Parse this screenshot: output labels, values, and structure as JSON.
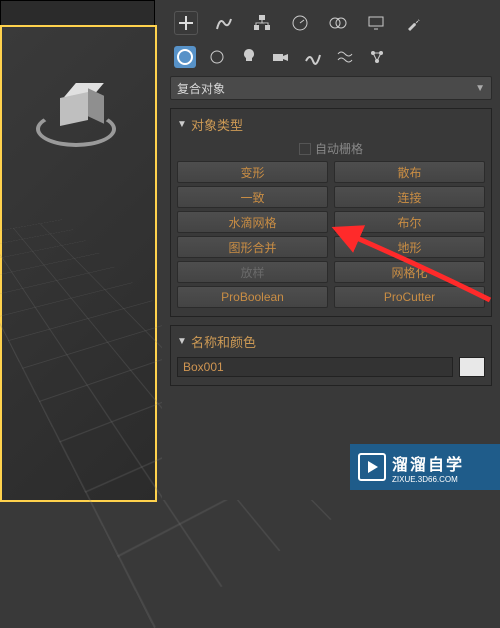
{
  "dropdown": {
    "value": "复合对象"
  },
  "rollouts": {
    "object_type": {
      "title": "对象类型",
      "autogrid": "自动栅格",
      "buttons": [
        {
          "label": "变形",
          "disabled": false
        },
        {
          "label": "散布",
          "disabled": false
        },
        {
          "label": "一致",
          "disabled": false
        },
        {
          "label": "连接",
          "disabled": false
        },
        {
          "label": "水滴网格",
          "disabled": false
        },
        {
          "label": "布尔",
          "disabled": false
        },
        {
          "label": "图形合并",
          "disabled": false
        },
        {
          "label": "地形",
          "disabled": false
        },
        {
          "label": "放样",
          "disabled": true
        },
        {
          "label": "网格化",
          "disabled": false
        },
        {
          "label": "ProBoolean",
          "disabled": false
        },
        {
          "label": "ProCutter",
          "disabled": false
        }
      ]
    },
    "name_color": {
      "title": "名称和颜色",
      "name_value": "Box001",
      "color": "#e8e8e8"
    }
  },
  "watermark": {
    "cn": "溜溜自学",
    "en": "ZIXUE.3D66.COM"
  },
  "icons": {
    "tab1": [
      "plus",
      "curve",
      "hier",
      "motion",
      "circles",
      "display",
      "wrench"
    ],
    "tab2": [
      "sphere",
      "bulb",
      "camera",
      "wave",
      "waves",
      "fx"
    ]
  }
}
